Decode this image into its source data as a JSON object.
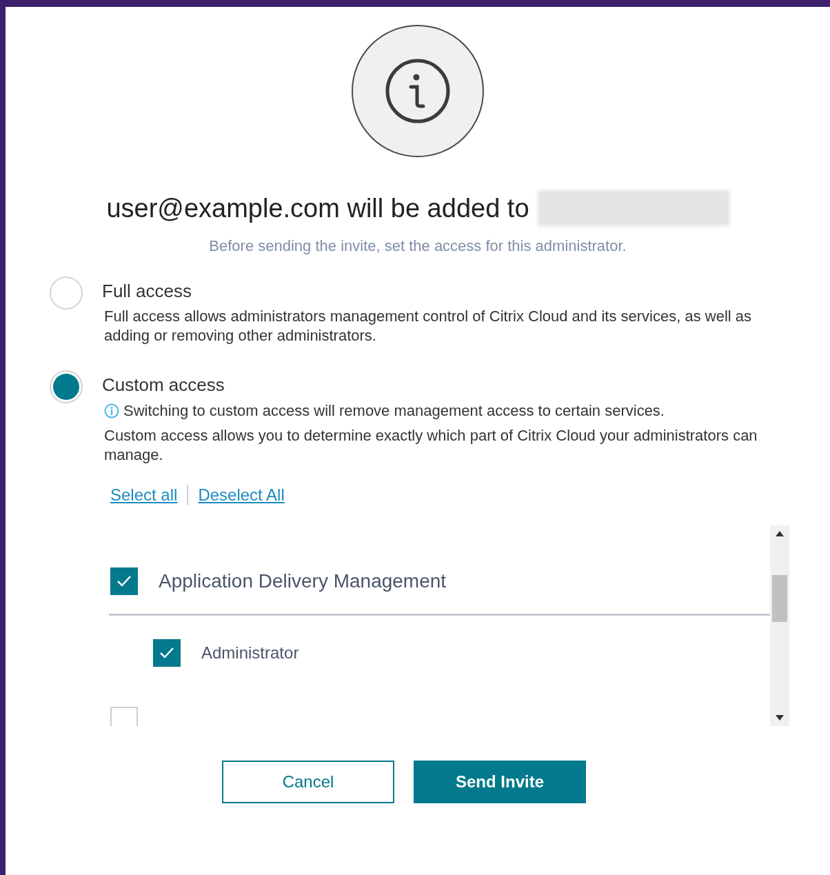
{
  "heading": "user@example.com will be added to",
  "subtitle": "Before sending the invite, set the access for this administrator.",
  "options": [
    {
      "label": "Full access",
      "selected": false,
      "description": "Full access allows administrators management control of Citrix Cloud and its services, as well as adding or removing other administrators."
    },
    {
      "label": "Custom access",
      "selected": true,
      "notice": "Switching to custom access will remove management access to certain services.",
      "description": "Custom access allows you to determine exactly which part of Citrix Cloud your administrators can manage."
    }
  ],
  "links": [
    "Select all",
    "Deselect All"
  ],
  "categories": [
    {
      "label": "Application Delivery Management",
      "checked": true,
      "children": [
        {
          "label": "Administrator",
          "checked": true
        }
      ]
    },
    {
      "checked": false
    }
  ],
  "buttons": [
    {
      "label": "Cancel",
      "kind": "secondary"
    },
    {
      "label": "Send Invite",
      "kind": "primary"
    }
  ]
}
